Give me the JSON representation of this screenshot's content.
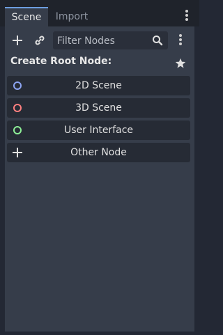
{
  "tabs": [
    {
      "label": "Scene",
      "active": true
    },
    {
      "label": "Import",
      "active": false
    }
  ],
  "toolbar": {
    "add_icon": "plus-icon",
    "link_icon": "link-icon",
    "filter_placeholder": "Filter Nodes",
    "filter_value": "",
    "search_icon": "search-icon",
    "menu_icon": "kebab-menu-icon"
  },
  "create_root": {
    "heading": "Create Root Node:",
    "favorite_icon": "star-icon",
    "items": [
      {
        "label": "2D Scene",
        "icon": "circle-icon",
        "color": "#8da5f3"
      },
      {
        "label": "3D Scene",
        "icon": "circle-icon",
        "color": "#fc7f7f"
      },
      {
        "label": "User Interface",
        "icon": "circle-icon",
        "color": "#8eef97"
      },
      {
        "label": "Other Node",
        "icon": "plus-icon",
        "color": "#e0e0e0"
      }
    ]
  },
  "colors": {
    "background": "#232834",
    "panel": "#363d4a",
    "button": "#262b35",
    "accent": "#6c9ee0"
  }
}
